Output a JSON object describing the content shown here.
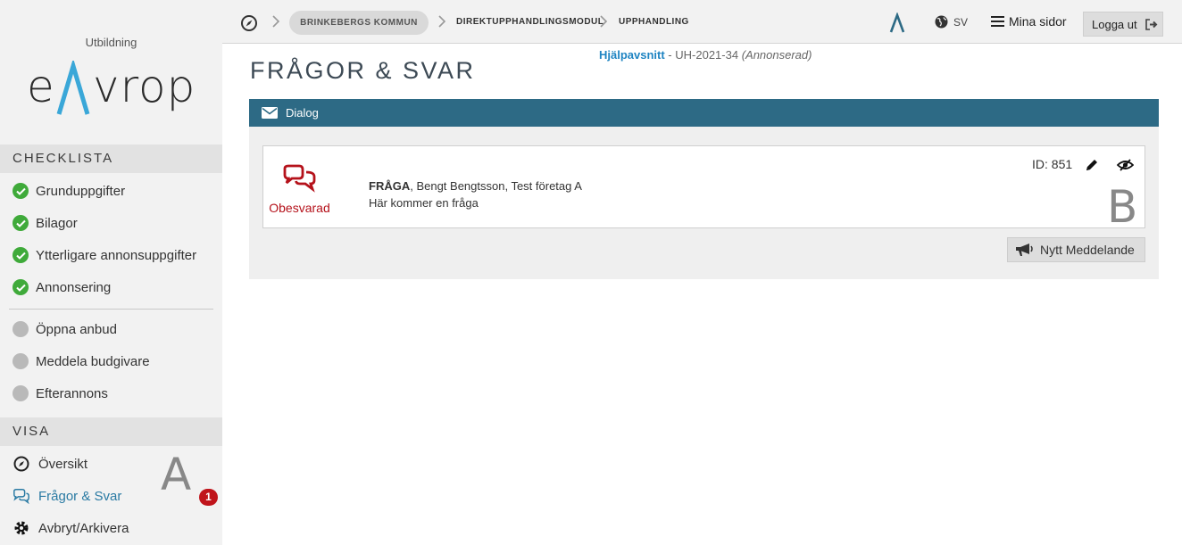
{
  "sidebar": {
    "logo_subtitle": "Utbildning",
    "logo_text": {
      "left": "e",
      "right": "vrop"
    },
    "checklist_title": "CHECKLISTA",
    "checklist_done": [
      {
        "label": "Grunduppgifter"
      },
      {
        "label": "Bilagor"
      },
      {
        "label": "Ytterligare annonsuppgifter"
      },
      {
        "label": "Annonsering"
      }
    ],
    "checklist_pending": [
      {
        "label": "Öppna anbud"
      },
      {
        "label": "Meddela budgivare"
      },
      {
        "label": "Efterannons"
      }
    ],
    "view_title": "VISA",
    "view_items": [
      {
        "label": "Översikt",
        "icon": "compass-icon"
      },
      {
        "label": "Frågor & Svar",
        "icon": "chat-icon"
      },
      {
        "label": "Avbryt/Arkivera",
        "icon": "gear-icon"
      }
    ],
    "annotation_letter": "A",
    "unread_badge": "1"
  },
  "topbar": {
    "breadcrumb": [
      "BRINKEBERGS KOMMUN",
      "DIREKTUPPHANDLINGSMODUL",
      "UPPHANDLING"
    ],
    "language": "SV",
    "menu_label": "Mina sidor",
    "logout_label": "Logga ut"
  },
  "header": {
    "help_link": "Hjälpavsnitt",
    "separator": " - ",
    "case_id": "UH-2021-34",
    "case_status": "(Annonserad)"
  },
  "page": {
    "title": "FRÅGOR & SVAR",
    "dialog_title": "Dialog"
  },
  "message": {
    "status_label": "Obesvarad",
    "kind": "FRÅGA",
    "author": ", Bengt Bengtsson, Test företag A",
    "body": "Här kommer en fråga",
    "id_label": "ID: 851",
    "annotation_letter": "B"
  },
  "actions": {
    "new_message_label": "Nytt Meddelande"
  },
  "colors": {
    "accent": "#2d6a85",
    "link": "#1f84c2",
    "done": "#3faa3a",
    "pending": "#b9b9b9",
    "alert": "#b5121b"
  }
}
